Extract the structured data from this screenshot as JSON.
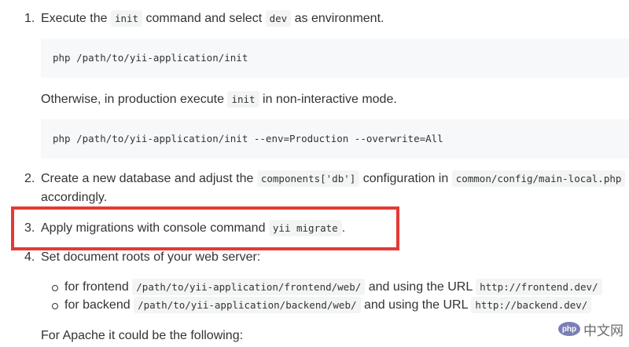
{
  "steps": [
    {
      "number": "1.",
      "before": "Execute the ",
      "code1": "init",
      "middle": " command and select ",
      "code2": "dev",
      "after": " as environment."
    },
    {
      "number": "2.",
      "before": "Create a new database and adjust the ",
      "code1": "components['db']",
      "middle": " configuration in ",
      "code2": "common/config/main-local.php",
      "line2": "accordingly."
    },
    {
      "number": "3.",
      "before": "Apply migrations with console command ",
      "code1": "yii migrate",
      "after": "."
    },
    {
      "number": "4.",
      "text": "Set document roots of your web server:"
    }
  ],
  "code_blocks": [
    "php /path/to/yii-application/init",
    "php /path/to/yii-application/init --env=Production --overwrite=All"
  ],
  "otherwise": {
    "before": "Otherwise, in production execute ",
    "code": "init",
    "after": " in non-interactive mode."
  },
  "sub_items": [
    {
      "before": "for frontend ",
      "path": "/path/to/yii-application/frontend/web/",
      "middle": " and using the URL ",
      "url": "http://frontend.dev/"
    },
    {
      "before": "for backend ",
      "path": "/path/to/yii-application/backend/web/",
      "middle": " and using the URL ",
      "url": "http://backend.dev/"
    }
  ],
  "apache_note": "For Apache it could be the following:",
  "watermark": {
    "logo": "php",
    "text": "中文网"
  },
  "colors": {
    "highlight_border": "#e53935",
    "code_bg": "#f6f8fa"
  }
}
